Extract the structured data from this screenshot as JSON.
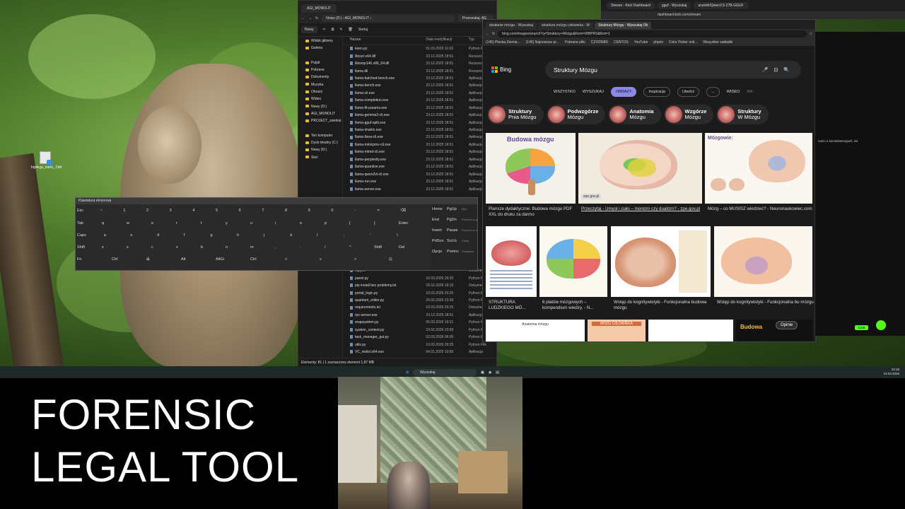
{
  "overlay": {
    "line1": "FORENSIC",
    "line2": "LEGAL TOOL"
  },
  "desktop": {
    "icon_label": "Injekcja_mem_.Odt"
  },
  "explorer": {
    "tab_title": "AGI_MONOLIT",
    "crumbs": "Nowy (D:) › AGI_MONOLIT ›",
    "search_placeholder": "Przeszukaj: AG",
    "new_button": "Nowy",
    "sort_label": "Sortuj",
    "columns": {
      "name": "Nazwa",
      "date": "Data modyfikacji",
      "type": "Typ"
    },
    "nav": [
      "Widok główny",
      "Galeria",
      "",
      "Pulpit",
      "Pobrane",
      "Dokumenty",
      "Muzyka",
      "Obrazy",
      "Wideo",
      "Nowy (D:)",
      "AGI_MONOLIT",
      "PROJECT_zwinkst",
      "",
      "Ten komputer",
      "Dysk lokalny (C:)",
      "Nowy (D:)",
      "Sieć"
    ],
    "files": [
      {
        "name": "keen.py",
        "date": "01.03.2026 11:03",
        "type": "Python File"
      },
      {
        "name": "libcurl-x64.dll",
        "date": "23.12.2025 18:51",
        "type": "Rozszerzenie"
      },
      {
        "name": "libiomp140.x86_64.dll",
        "date": "23.12.2025 18:51",
        "type": "Rozszerzenie"
      },
      {
        "name": "llama.dll",
        "date": "23.12.2025 18:51",
        "type": "Rozszerzenie"
      },
      {
        "name": "llama-batched-bench.exe",
        "date": "23.12.2025 18:51",
        "type": "Aplikacja"
      },
      {
        "name": "llama-bench.exe",
        "date": "23.12.2025 18:51",
        "type": "Aplikacja"
      },
      {
        "name": "llama-cli.exe",
        "date": "23.12.2025 18:51",
        "type": "Aplikacja"
      },
      {
        "name": "llama-completion.exe",
        "date": "23.12.2025 18:51",
        "type": "Aplikacja"
      },
      {
        "name": "llama-fit-params.exe",
        "date": "23.12.2025 18:51",
        "type": "Aplikacja"
      },
      {
        "name": "llama-gemma3-cli.exe",
        "date": "23.12.2025 18:51",
        "type": "Aplikacja"
      },
      {
        "name": "llama-gguf-split.exe",
        "date": "23.12.2025 18:51",
        "type": "Aplikacja"
      },
      {
        "name": "llama-imatrix.exe",
        "date": "23.12.2025 18:51",
        "type": "Aplikacja"
      },
      {
        "name": "llama-llava-cli.exe",
        "date": "23.12.2025 18:51",
        "type": "Aplikacja"
      },
      {
        "name": "llama-minicpmv-cli.exe",
        "date": "23.12.2025 18:51",
        "type": "Aplikacja"
      },
      {
        "name": "llama-mtmd-cli.exe",
        "date": "23.12.2025 18:51",
        "type": "Aplikacja"
      },
      {
        "name": "llama-perplexity.exe",
        "date": "23.12.2025 18:51",
        "type": "Aplikacja"
      },
      {
        "name": "llama-quantize.exe",
        "date": "23.12.2025 18:51",
        "type": "Aplikacja"
      },
      {
        "name": "llama-qwen2vl-cli.exe",
        "date": "23.12.2025 18:51",
        "type": "Aplikacja"
      },
      {
        "name": "llama-run.exe",
        "date": "23.12.2025 18:51",
        "type": "Aplikacja"
      },
      {
        "name": "llama-server.exe",
        "date": "23.12.2025 18:51",
        "type": "Aplikacja"
      }
    ],
    "files_bottom": [
      {
        "name": "mpy.m",
        "date": "",
        "type": "Dokument T"
      },
      {
        "name": "panel.py",
        "date": "10.03.2026 20:25",
        "type": "Python File"
      },
      {
        "name": "pip install bez problemy.txt",
        "date": "18.02.2026 16:19",
        "type": "Dokument T"
      },
      {
        "name": "portal_logic.py",
        "date": "10.03.2026 20:25",
        "type": "Python File"
      },
      {
        "name": "quantum_editor.py",
        "date": "24.02.2026 23:39",
        "type": "Python File"
      },
      {
        "name": "requirements.txt",
        "date": "10.03.2026 20:25",
        "type": "Dokument T"
      },
      {
        "name": "rpc-server.exe",
        "date": "23.12.2025 18:51",
        "type": "Aplikacja"
      },
      {
        "name": "snapsystem.py",
        "date": "05.03.2026 16:21",
        "type": "Python File"
      },
      {
        "name": "system_context.py",
        "date": "23.02.2026 23:59",
        "type": "Python File"
      },
      {
        "name": "task_manager_gui.py",
        "date": "02.03.2026 06:05",
        "type": "Python File"
      },
      {
        "name": "utils.py",
        "date": "10.03.2026 20:25",
        "type": "Python File"
      },
      {
        "name": "VC_redist.x64.exe",
        "date": "04.01.2026 10:56",
        "type": "Aplikacja"
      }
    ],
    "status": "Elementy: 81  |  1 zaznaczony element  1,87 MB"
  },
  "osk": {
    "title": "Klawiatura ekranowa",
    "rows": [
      [
        "Esc",
        "~",
        "1",
        "2",
        "3",
        "4",
        "5",
        "6",
        "7",
        "8",
        "9",
        "0",
        "-",
        "=",
        "⌫"
      ],
      [
        "Tab",
        "q",
        "w",
        "e",
        "r",
        "t",
        "y",
        "u",
        "i",
        "o",
        "p",
        "[",
        "]",
        "Enter"
      ],
      [
        "Caps",
        "a",
        "s",
        "d",
        "f",
        "g",
        "h",
        "j",
        "k",
        "l",
        ";",
        "'",
        "\\"
      ],
      [
        "Shift",
        "z",
        "x",
        "c",
        "v",
        "b",
        "n",
        "m",
        ",",
        ".",
        "/",
        "^",
        "Shift",
        "Del"
      ],
      [
        "Fn",
        "Ctrl",
        "⊞",
        "Alt",
        "AltGr",
        "Ctrl",
        "<",
        "v",
        ">",
        "⊡"
      ]
    ],
    "right": [
      [
        "Home",
        "PgUp",
        "Nav"
      ],
      [
        "End",
        "PgDn",
        "Przesuń w górę"
      ],
      [
        "Insert",
        "Pause",
        "Przesuń w dół"
      ],
      [
        "PrtScn",
        "ScrLk",
        "Dokuj"
      ],
      [
        "Opcje",
        "Pomoc",
        "Zanikanie"
      ]
    ]
  },
  "browser": {
    "tabs": [
      "działanie mózgu - Wyszukaj",
      "struktura mózgu człowieka - W",
      "Struktury Mózgu - Wyszukaj Ob"
    ],
    "url": "bing.com/images/search?q=Struktury+Mózgu&form=IRBPRS&first=1",
    "bookmarks": [
      "(145) Płoska Ziemia...",
      "(145) Najnowsze pr...",
      "Pobrane pliki",
      "CZODNIRI",
      "CENTOS",
      "YouTube",
      "phpini",
      "Color Picker onli...",
      "Wszystkie zakładki"
    ],
    "logo": "Bing",
    "query": "Struktury Mózgu",
    "nav": [
      "WSZYSTKO",
      "WYSZUKAJ",
      "OBRAZY",
      "Inspiracja",
      "Utwórz",
      "...",
      "WIDEO",
      "MA"
    ],
    "related": [
      {
        "a": "Struktury",
        "b": "Pnia Mózgu"
      },
      {
        "a": "Podwzgórze",
        "b": "Mózgu"
      },
      {
        "a": "Anatomia",
        "b": "Mózgu"
      },
      {
        "a": "Wzgórze",
        "b": "Mózgu"
      },
      {
        "a": "Struktury",
        "b": "W Mózgu"
      }
    ],
    "results_row1": [
      {
        "title": "Budowa mózgu",
        "caption": "Plansze dydaktyczne: Budowa mózgu PDF XXL do druku za darmo"
      },
      {
        "title": "",
        "caption": "Przeczytaj - Umysł i ciało – monizm czy dualizm? - zpe.gov.pl",
        "source": "zpe.gov.pl"
      },
      {
        "title": "Mózgowie:",
        "caption": "Mózg – co MUSISZ wiedzieć? - Neuronaukowiec.com"
      }
    ],
    "results_row2": [
      {
        "caption": "STRUKTURA LUDZKIEGO MÓ..."
      },
      {
        "caption": "6 płatów mózgowych – kompendium wiedzy. - N..."
      },
      {
        "caption": "Wstęp do kognitywistyki - Funkcjonalna budowa mózgu"
      },
      {
        "caption": "Wstęp do kognitywistyki - Funkcjonalna bu mózgu"
      }
    ],
    "results_row3": [
      "Anatomia mózgu",
      "MÓZG CZŁOWIEKA",
      "",
      "Budowa"
    ],
    "opinie": "Opinie"
  },
  "top_window": {
    "tabs": [
      "Stream - Kick Dashboard",
      "gguf - Wyszukaj",
      "unsloth/Qwen3.5-27B-GGUF"
    ],
    "url": "dashboard.kick.com/stream"
  },
  "right_panel": {
    "text": "ności o konsekwencjach. Za",
    "chat": "Czat"
  },
  "taskbar": {
    "search": "Wyszukaj",
    "time": "23:18",
    "date": "19.03.2026"
  }
}
